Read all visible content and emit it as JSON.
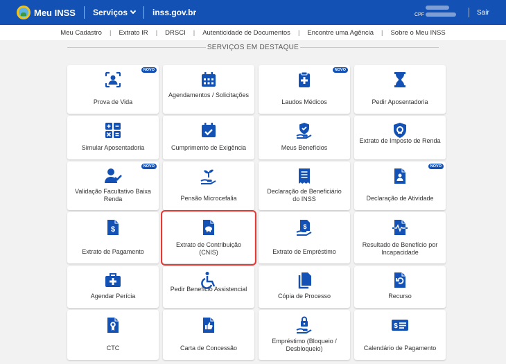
{
  "header": {
    "title": "Meu INSS",
    "services_label": "Serviços",
    "domain": "inss.gov.br",
    "cpf_label": "CPF",
    "logout_label": "Sair"
  },
  "topnav": [
    "Meu Cadastro",
    "Extrato IR",
    "DRSCI",
    "Autenticidade de Documentos",
    "Encontre uma Agência",
    "Sobre o Meu INSS"
  ],
  "section_title": "SERVIÇOS EM DESTAQUE",
  "badge_text": "NOVO",
  "colors": {
    "primary": "#1351b4",
    "highlight": "#e53935",
    "background": "#f2f2f2"
  },
  "cards": [
    {
      "label": "Prova de Vida",
      "icon": "person-scan-icon",
      "badge": true
    },
    {
      "label": "Agendamentos / Solicitações",
      "icon": "calendar-icon",
      "badge": false
    },
    {
      "label": "Laudos Médicos",
      "icon": "medical-clipboard-icon",
      "badge": true
    },
    {
      "label": "Pedir Aposentadoria",
      "icon": "hourglass-icon",
      "badge": false
    },
    {
      "label": "Simular Aposentadoria",
      "icon": "calculator-icon",
      "badge": false
    },
    {
      "label": "Cumprimento de Exigência",
      "icon": "calendar-check-icon",
      "badge": false
    },
    {
      "label": "Meus Benefícios",
      "icon": "hand-shield-icon",
      "badge": false
    },
    {
      "label": "Extrato de Imposto de Renda",
      "icon": "lion-shield-icon",
      "badge": false
    },
    {
      "label": "Validação Facultativo Baixa Renda",
      "icon": "person-check-icon",
      "badge": true
    },
    {
      "label": "Pensão Microcefalia",
      "icon": "hand-plant-icon",
      "badge": false
    },
    {
      "label": "Declaração de Beneficiário do INSS",
      "icon": "receipt-icon",
      "badge": false
    },
    {
      "label": "Declaração de Atividade",
      "icon": "person-document-icon",
      "badge": true
    },
    {
      "label": "Extrato de Pagamento",
      "icon": "money-document-icon",
      "badge": false
    },
    {
      "label": "Extrato de Contribuição (CNIS)",
      "icon": "piggy-document-icon",
      "badge": false
    },
    {
      "label": "Extrato de Empréstimo",
      "icon": "hand-document-icon",
      "badge": false
    },
    {
      "label": "Resultado de Benefício por Incapacidade",
      "icon": "heartbeat-document-icon",
      "badge": false
    },
    {
      "label": "Agendar Perícia",
      "icon": "medical-kit-icon",
      "badge": false
    },
    {
      "label": "Pedir Benefício Assistencial",
      "icon": "wheelchair-icon",
      "badge": false
    },
    {
      "label": "Cópia de Processo",
      "icon": "copy-icon",
      "badge": false
    },
    {
      "label": "Recurso",
      "icon": "undo-document-icon",
      "badge": false
    },
    {
      "label": "CTC",
      "icon": "certificate-document-icon",
      "badge": false
    },
    {
      "label": "Carta de Concessão",
      "icon": "thumbs-up-document-icon",
      "badge": false
    },
    {
      "label": "Empréstimo (Bloqueio / Desbloqueio)",
      "icon": "hand-lock-icon",
      "badge": false
    },
    {
      "label": "Calendário de Pagamento",
      "icon": "money-card-icon",
      "badge": false
    }
  ]
}
